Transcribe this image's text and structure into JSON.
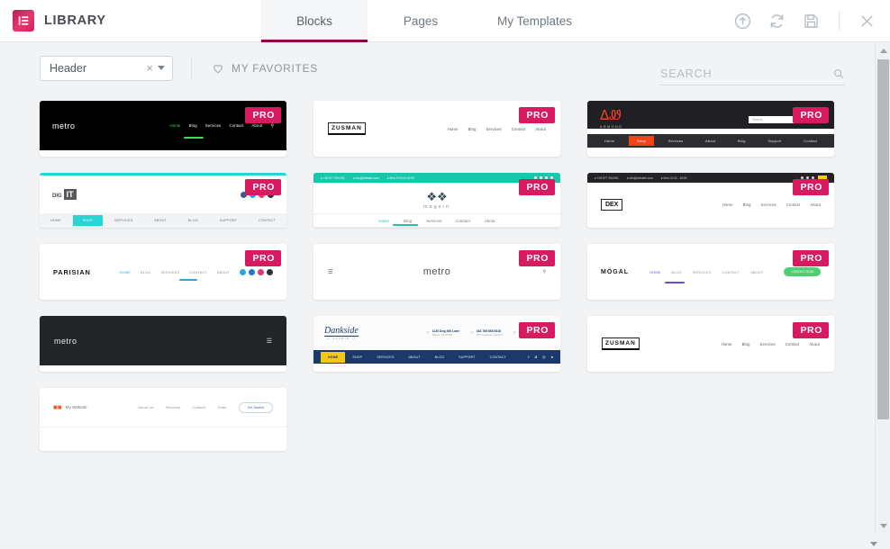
{
  "header": {
    "brand_title": "LIBRARY",
    "logo_icon": "elementor-logo-icon",
    "tabs": [
      {
        "label": "Blocks",
        "active": true
      },
      {
        "label": "Pages",
        "active": false
      },
      {
        "label": "My Templates",
        "active": false
      }
    ],
    "actions": [
      {
        "name": "upload-icon",
        "title": "Import Template"
      },
      {
        "name": "sync-icon",
        "title": "Sync Library"
      },
      {
        "name": "save-icon",
        "title": "Save"
      },
      {
        "name": "close-icon",
        "title": "Close"
      }
    ],
    "accent_color": "#93003f",
    "brand_color": "#d81b60"
  },
  "toolbar": {
    "filter_value": "Header",
    "filter_clear_label": "×",
    "favorites_label": "MY FAVORITES",
    "favorites_icon": "heart-icon"
  },
  "search": {
    "value": "",
    "placeholder": "SEARCH",
    "icon": "search-icon"
  },
  "badges": {
    "pro_label": "PRO"
  },
  "templates": [
    {
      "id": "metro-dark-nav",
      "logo": "metro",
      "pro": true,
      "style": "dark-nav",
      "bg": "#000000",
      "accent": "#3ddc57",
      "nav": [
        "Home",
        "Blog",
        "Services",
        "Contact",
        "About"
      ],
      "active_nav": "Home",
      "has_search_icon": true
    },
    {
      "id": "zusman-light",
      "logo": "ZUSMAN",
      "pro": true,
      "style": "light-nav",
      "bg": "#ffffff",
      "accent": "#333333",
      "nav": [
        "Home",
        "Blog",
        "Services",
        "Contact",
        "About"
      ],
      "active_nav": "",
      "has_search_icon": false
    },
    {
      "id": "armond-dark",
      "logo": "ARMOND",
      "pro": true,
      "style": "dark-searchbar",
      "bg": "#201f23",
      "accent": "#f0451c",
      "nav": [
        "Home",
        "Shop",
        "Services",
        "About",
        "Blog",
        "Support",
        "Contact"
      ],
      "active_nav": "Shop",
      "search_placeholder": "Search...",
      "has_search_icon": true
    },
    {
      "id": "digit-cyan",
      "logo": "DIG IT",
      "pro": true,
      "style": "topbar-nav",
      "bg": "#ffffff",
      "accent": "#29d4d4",
      "nav": [
        "HOME",
        "SHOP",
        "SERVICES",
        "ABOUT",
        "BLOG",
        "SUPPORT",
        "CONTACT"
      ],
      "active_nav": "SHOP",
      "socials": [
        "#3b5998",
        "#1da1f2",
        "#e4405f",
        "#333333"
      ]
    },
    {
      "id": "magein-teal",
      "logo": "magein",
      "pro": true,
      "style": "contactbar-center",
      "bg": "#ffffff",
      "accent": "#18c7a9",
      "nav": [
        "Home",
        "Blog",
        "Services",
        "Contact",
        "About"
      ],
      "active_nav": "Home",
      "contact": [
        "+63 977 594 281",
        "info@website.com",
        "Mon-Fri 9:00-18:00"
      ]
    },
    {
      "id": "dark-contactbar",
      "logo": "DEX",
      "pro": true,
      "style": "contactbar-dark",
      "bg": "#ffffff",
      "accent": "#f5d000",
      "nav": [
        "Home",
        "Blog",
        "Services",
        "Contact",
        "About"
      ],
      "active_nav": "",
      "contact": [
        "+06 877 394 501",
        "info@website.com",
        "Mon 01:00 - 18:00"
      ]
    },
    {
      "id": "parisian-social",
      "logo": "PARISIAN",
      "pro": true,
      "style": "light-social",
      "bg": "#ffffff",
      "accent": "#29a8e0",
      "nav": [
        "HOME",
        "BLOG",
        "SERVICES",
        "CONTACT",
        "ABOUT"
      ],
      "active_nav": "HOME",
      "socials": [
        "#29a8e0",
        "#1f78d1",
        "#e0367c",
        "#2e3239"
      ]
    },
    {
      "id": "metro-minimal",
      "logo": "metro",
      "pro": true,
      "style": "minimal-center",
      "bg": "#ffffff",
      "accent": "#888888",
      "nav": [],
      "active_nav": "",
      "has_search_icon": true,
      "has_hamburger": true
    },
    {
      "id": "mogal-cta",
      "logo": "MÖGAL",
      "pro": true,
      "style": "light-cta",
      "bg": "#ffffff",
      "accent": "#6c4ad6",
      "nav": [
        "HOME",
        "BLOG",
        "SERVICES",
        "CONTACT",
        "ABOUT"
      ],
      "active_nav": "HOME",
      "cta_label": "CONTACT NOW",
      "cta_color": "#4fcf6f"
    },
    {
      "id": "metro-dark-burger",
      "logo": "metro",
      "pro": false,
      "style": "dark-burger",
      "bg": "#232629",
      "accent": "#ffffff",
      "nav": [],
      "active_nav": "",
      "has_hamburger": true
    },
    {
      "id": "dankside-navy",
      "logo": "Dankside",
      "logo_sub": "STUDIO",
      "pro": true,
      "style": "navy-info",
      "bg": "#ffffff",
      "accent": "#f5c518",
      "navbar_bg": "#1b3a6b",
      "nav": [
        "HOME",
        "SHOP",
        "SERVICES",
        "ABOUT",
        "BLOG",
        "SUPPORT",
        "CONTACT"
      ],
      "active_nav": "HOME",
      "info": [
        {
          "title": "1120 Dog 400 Lane",
          "sub": "Wilson, KS 67490"
        },
        {
          "title": "434 789.658 5316",
          "sub": "24/7 Customer Support"
        },
        {
          "title": "Mon - Fri 9:00 - 18:00",
          "sub": "Online store always open"
        }
      ],
      "socials": [
        "#ffffff",
        "#ffffff",
        "#ffffff",
        "#ffffff"
      ]
    },
    {
      "id": "zusman-light-2",
      "logo": "ZUSMAN",
      "pro": true,
      "style": "light-nav",
      "bg": "#ffffff",
      "accent": "#333333",
      "nav": [
        "Home",
        "Blog",
        "Services",
        "Contact",
        "About"
      ],
      "active_nav": "",
      "has_search_icon": false
    },
    {
      "id": "my-website-cta",
      "logo": "My Website",
      "pro": false,
      "style": "light-outline-cta",
      "bg": "#ffffff",
      "accent": "#f05a33",
      "nav": [
        "About Us",
        "Services",
        "Contact",
        "Team"
      ],
      "active_nav": "",
      "cta_label": "Get Started"
    }
  ],
  "scrollbar": {
    "up_icon": "caret-up-icon",
    "down_icon": "caret-down-icon"
  }
}
